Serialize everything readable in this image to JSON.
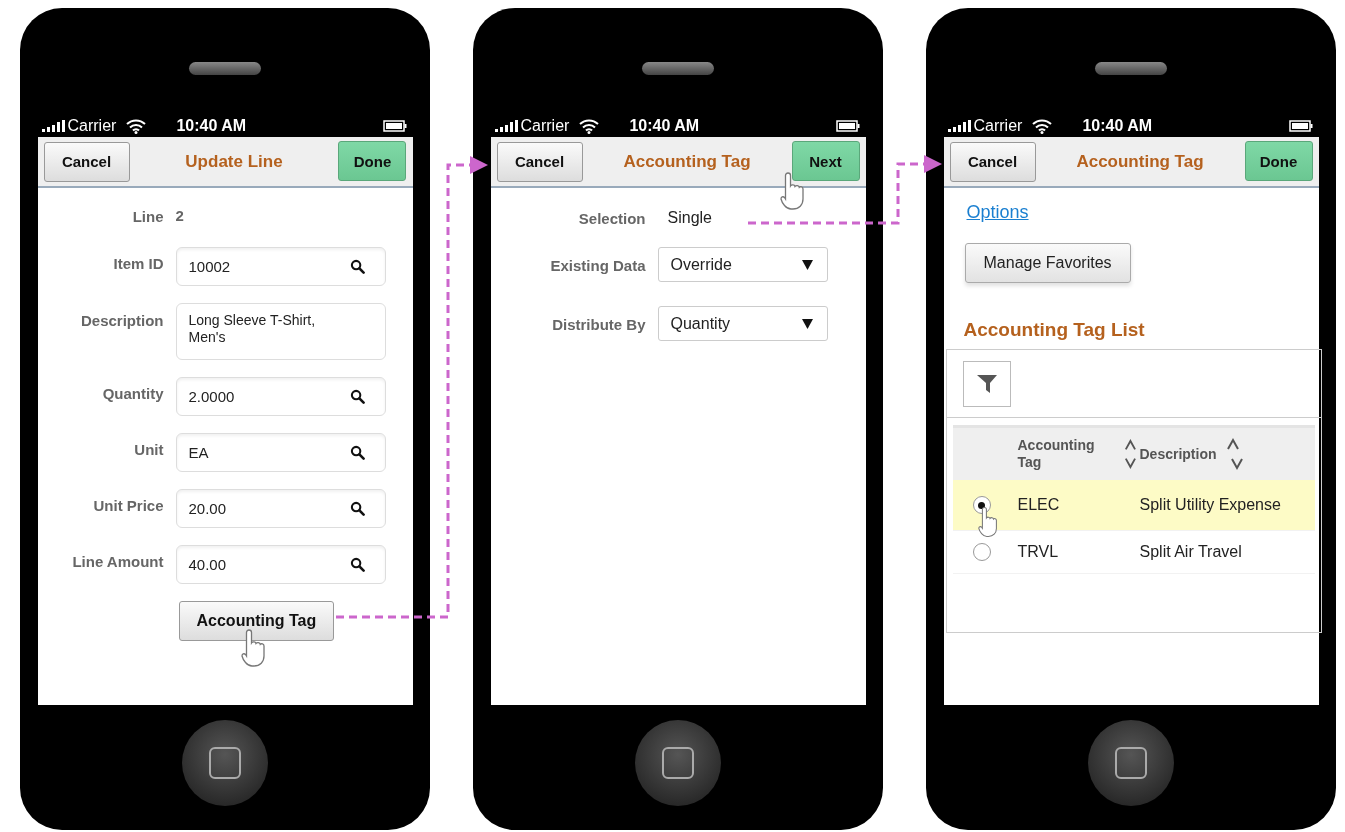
{
  "screens": [
    {
      "status": {
        "carrier": "Carrier",
        "time": "10:40 AM"
      },
      "header": {
        "left": "Cancel",
        "title": "Update Line",
        "right": "Done"
      },
      "body": [
        {
          "kind": "display",
          "label": "Line",
          "value": "2"
        },
        {
          "kind": "lookup",
          "label": "Item ID",
          "value": "10002"
        },
        {
          "kind": "textarea",
          "label": "Description",
          "value": "Long Sleeve T-Shirt, Men's"
        },
        {
          "kind": "lookup",
          "label": "Quantity",
          "value": "2.0000"
        },
        {
          "kind": "lookup",
          "label": "Unit",
          "value": "EA"
        },
        {
          "kind": "lookup",
          "label": "Unit Price",
          "value": "20.00"
        },
        {
          "kind": "lookup",
          "label": "Line Amount",
          "value": "40.00"
        },
        {
          "kind": "action",
          "label": "Accounting Tag"
        }
      ]
    },
    {
      "status": {
        "carrier": "Carrier",
        "time": "10:40 AM"
      },
      "header": {
        "left": "Cancel",
        "title": "Accounting Tag",
        "right": "Next"
      },
      "body": [
        {
          "kind": "text",
          "label": "Selection",
          "value": "Single"
        },
        {
          "kind": "select",
          "label": "Existing Data",
          "value": "Override"
        },
        {
          "kind": "select",
          "label": "Distribute By",
          "value": "Quantity"
        }
      ]
    },
    {
      "status": {
        "carrier": "Carrier",
        "time": "10:40 AM"
      },
      "header": {
        "left": "Cancel",
        "title": "Accounting Tag",
        "right": "Done"
      },
      "body": [
        {
          "kind": "link",
          "label": "Options"
        },
        {
          "kind": "button",
          "label": "Manage Favorites"
        },
        {
          "kind": "heading",
          "label": "Accounting Tag List"
        },
        {
          "kind": "grid",
          "columns": [
            "Accounting Tag",
            "Description"
          ],
          "rows": [
            {
              "tag": "ELEC",
              "description": "Split Utility Expense",
              "selected": true
            },
            {
              "tag": "TRVL",
              "description": "Split Air Travel",
              "selected": false
            }
          ]
        }
      ]
    }
  ]
}
